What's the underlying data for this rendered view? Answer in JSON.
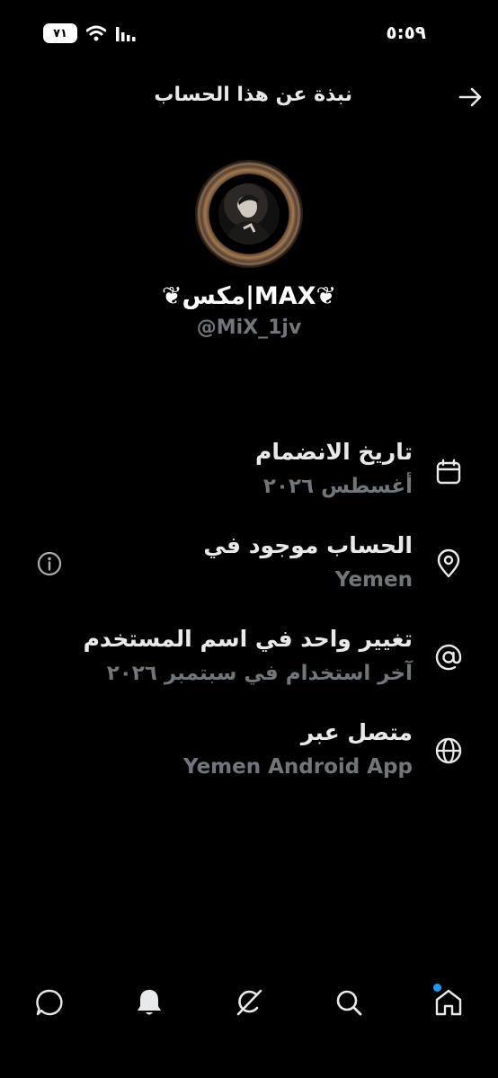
{
  "status_bar": {
    "battery": "٧١",
    "time": "٥:٥٩"
  },
  "header": {
    "title": "نبذة عن هذا الحساب"
  },
  "profile": {
    "display_name": "❦مكس|MAX❦",
    "handle": "@MiX_1jv"
  },
  "rows": [
    {
      "title": "تاريخ الانضمام",
      "subtitle": "أغسطس ٢٠٢٦",
      "icon": "calendar-icon"
    },
    {
      "title": "الحساب موجود في",
      "subtitle": "Yemen",
      "icon": "location-pin-icon"
    },
    {
      "title": "تغيير واحد في اسم المستخدم",
      "subtitle": "آخر استخدام في سبتمبر ٢٠٢٦",
      "icon": "at-sign-icon"
    },
    {
      "title": "متصل عبر",
      "subtitle": "Yemen Android App",
      "icon": "globe-icon"
    }
  ],
  "colors": {
    "background": "#000000",
    "primary_text": "#e7e9ea",
    "secondary_text": "#71767b",
    "accent": "#1d9bf0"
  }
}
